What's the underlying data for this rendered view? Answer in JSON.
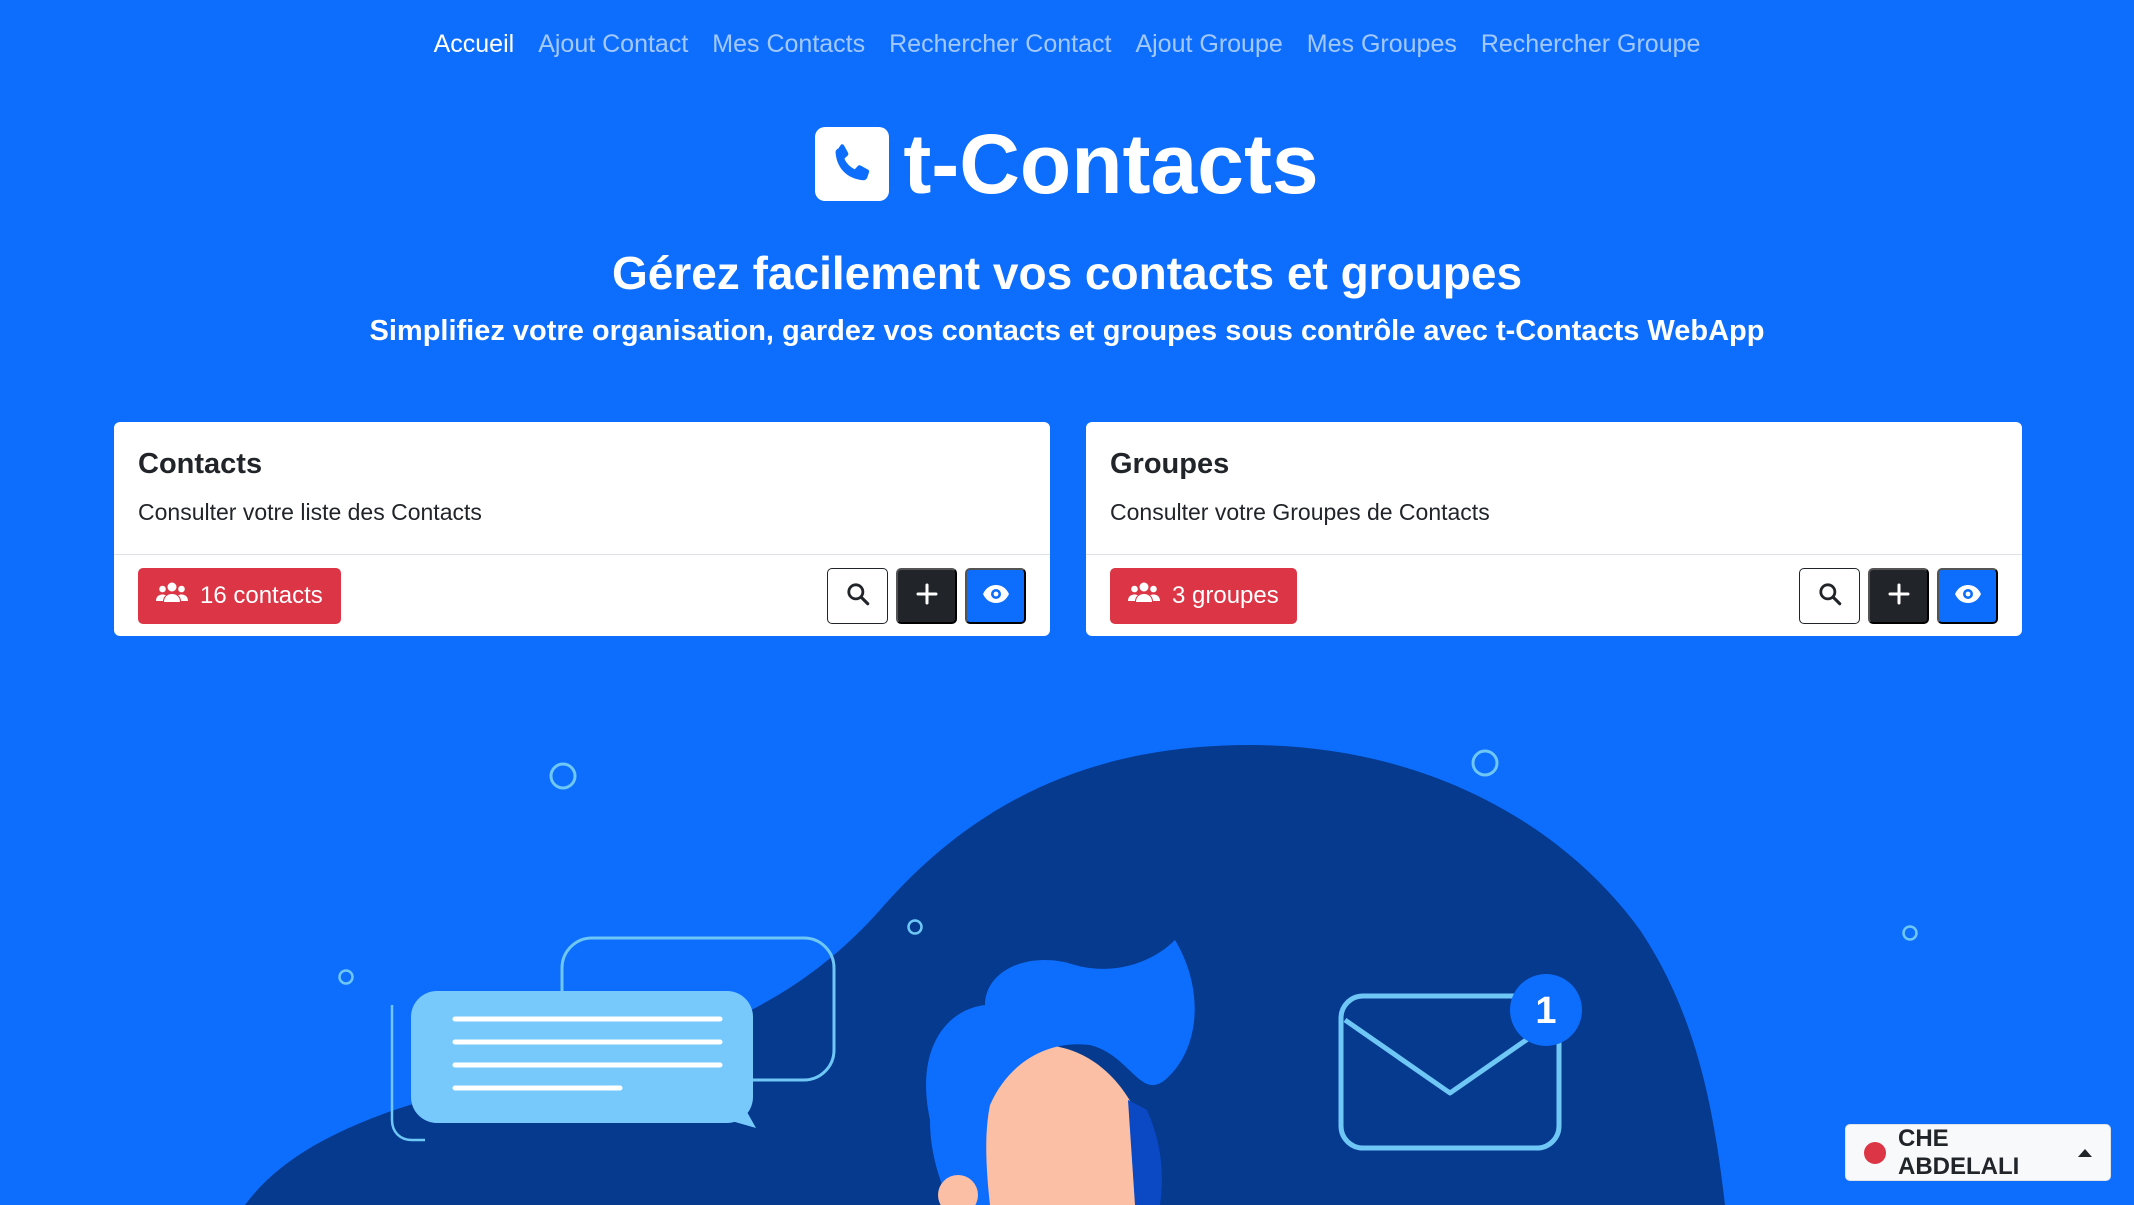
{
  "nav": {
    "items": [
      {
        "label": "Accueil",
        "active": true
      },
      {
        "label": "Ajout Contact"
      },
      {
        "label": "Mes Contacts"
      },
      {
        "label": "Rechercher Contact"
      },
      {
        "label": "Ajout Groupe"
      },
      {
        "label": "Mes Groupes"
      },
      {
        "label": "Rechercher Groupe"
      }
    ]
  },
  "brand": {
    "name": "t-Contacts",
    "icon": "phone-icon"
  },
  "hero": {
    "title": "Gérez facilement vos contacts et groupes",
    "subtitle": "Simplifiez votre organisation, gardez vos contacts et groupes sous contrôle avec t-Contacts WebApp"
  },
  "cards": {
    "contacts": {
      "title": "Contacts",
      "text": "Consulter votre liste des Contacts",
      "badge": "16 contacts"
    },
    "groups": {
      "title": "Groupes",
      "text": "Consulter votre Groupes de Contacts",
      "badge": "3 groupes"
    }
  },
  "illustration": {
    "notification_count": "1"
  },
  "user": {
    "name": "CHE ABDELALI",
    "status_color": "#dc3545"
  },
  "colors": {
    "background": "#0d6efd",
    "badge": "#dc3545",
    "dark": "#212529",
    "blob": "#053a8f"
  }
}
